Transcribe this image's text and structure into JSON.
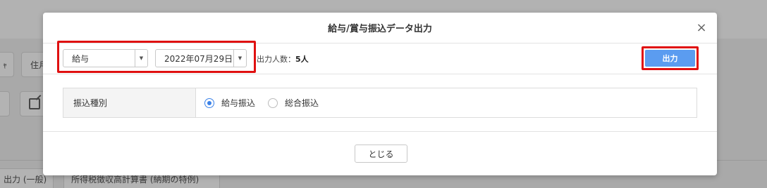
{
  "background": {
    "button_partial_1": "ｬ",
    "button_partial_2": "住月",
    "tabs": [
      {
        "label": "出力 (一般)"
      },
      {
        "label": "所得税徴収高計算書 (納期の特例)"
      }
    ]
  },
  "modal": {
    "title": "給与/賞与振込データ出力",
    "close_icon": "×",
    "toolbar": {
      "type_select": {
        "value": "給与"
      },
      "date_select": {
        "value": "2022年07月29日"
      },
      "count_label": "出力人数：",
      "count_value": "5人",
      "output_button": "出力"
    },
    "form": {
      "label": "振込種別",
      "options": [
        {
          "label": "給与振込",
          "checked": true
        },
        {
          "label": "総合振込",
          "checked": false
        }
      ]
    },
    "footer": {
      "close_button": "とじる"
    }
  },
  "colors": {
    "accent": "#5b9cf0",
    "radio_checked": "#3b82e8",
    "highlight": "#e01010"
  }
}
